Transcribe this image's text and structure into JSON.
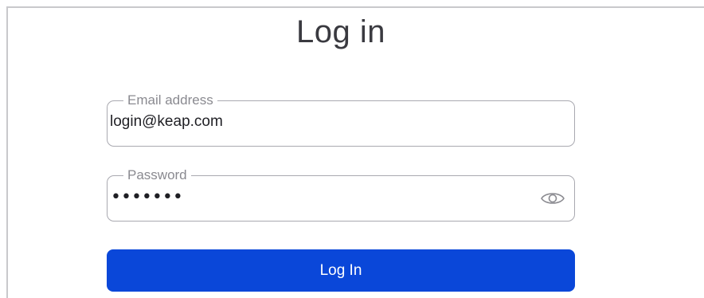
{
  "page": {
    "title": "Log in"
  },
  "form": {
    "email": {
      "label": "Email address",
      "value": "login@keap.com"
    },
    "password": {
      "label": "Password",
      "masked_value": "•••••••",
      "toggle_icon": "eye-icon"
    },
    "submit_label": "Log In"
  },
  "colors": {
    "primary_button": "#0a47d9",
    "field_border": "#a9a9b0",
    "label_text": "#8a8a90"
  }
}
